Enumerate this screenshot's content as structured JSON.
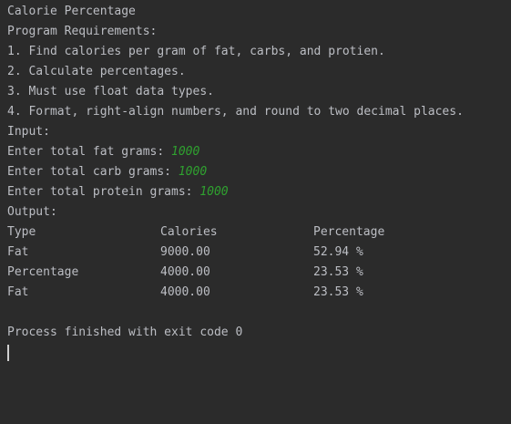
{
  "console": {
    "title": "Calorie Percentage",
    "requirements_header": "Program Requirements:",
    "requirements": [
      "1. Find calories per gram of fat, carbs, and protien.",
      "2. Calculate percentages.",
      "3. Must use float data types.",
      "4. Format, right-align numbers, and round to two decimal places."
    ],
    "input_header": "Input:",
    "prompts": [
      {
        "label": "Enter total fat grams: ",
        "value": "1000"
      },
      {
        "label": "Enter total carb grams: ",
        "value": "1000"
      },
      {
        "label": "Enter total protein grams: ",
        "value": "1000"
      }
    ],
    "output_header": "Output:",
    "table": {
      "headers": [
        "Type",
        "Calories",
        "Percentage"
      ],
      "rows": [
        [
          "Fat",
          "9000.00",
          "52.94 %"
        ],
        [
          "Percentage",
          "4000.00",
          "23.53 %"
        ],
        [
          "Fat",
          "4000.00",
          "23.53 %"
        ]
      ]
    },
    "exit_message": "Process finished with exit code 0"
  },
  "colors": {
    "background": "#2b2b2b",
    "text": "#bcbec4",
    "input": "#2fa12f"
  }
}
